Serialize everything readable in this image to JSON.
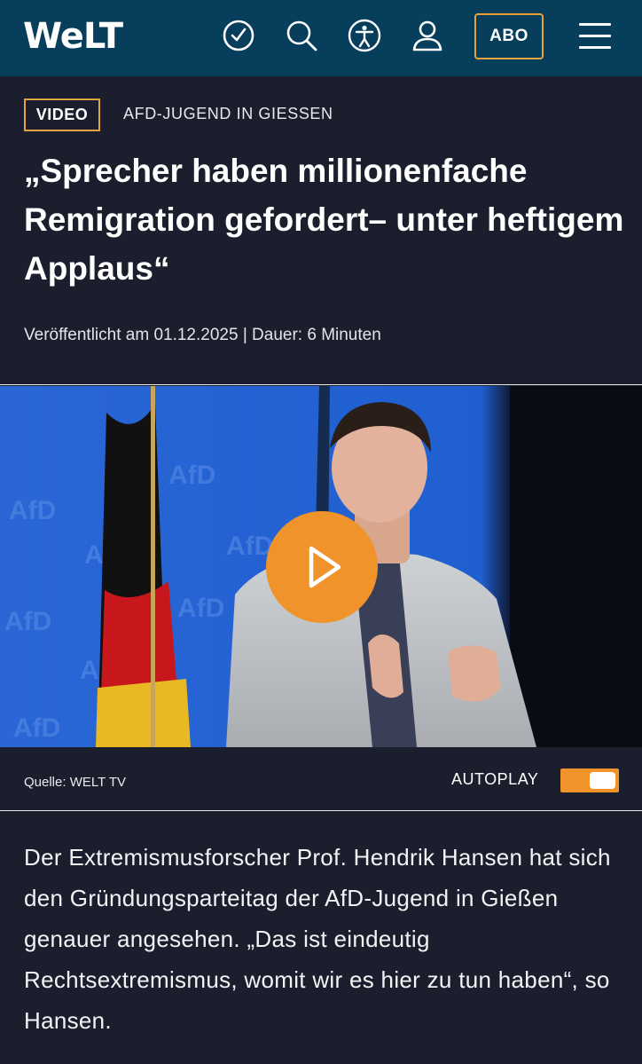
{
  "header": {
    "logo": "WeLT",
    "icons": [
      "clock-check-icon",
      "search-icon",
      "accessibility-icon",
      "user-icon"
    ],
    "abo_label": "ABO",
    "menu_icon": "hamburger-menu-icon",
    "background": "#073e5b"
  },
  "article": {
    "tag": "VIDEO",
    "kicker": "AFD-JUGEND IN GIESSEN",
    "headline": "„Sprecher haben millionenfache Remigration gefordert– unter heftigem Applaus“",
    "meta": "Veröffentlicht am 01.12.2025  |  Dauer: 6 Minuten",
    "body": "Der Extremismusforscher Prof. Hendrik Hansen hat sich den Gründungsparteitag der AfD-Jugend in Gießen genauer angesehen. „Das ist eindeutig Rechtsextremismus, womit wir es hier zu tun haben“, so Hansen."
  },
  "video": {
    "play_icon": "play-icon",
    "source": "Quelle: WELT TV",
    "autoplay_label": "AUTOPLAY",
    "autoplay_on": true
  },
  "colors": {
    "page_bg": "#1b1f2d",
    "accent": "#f0932b",
    "tag_border": "#e6a23d"
  }
}
